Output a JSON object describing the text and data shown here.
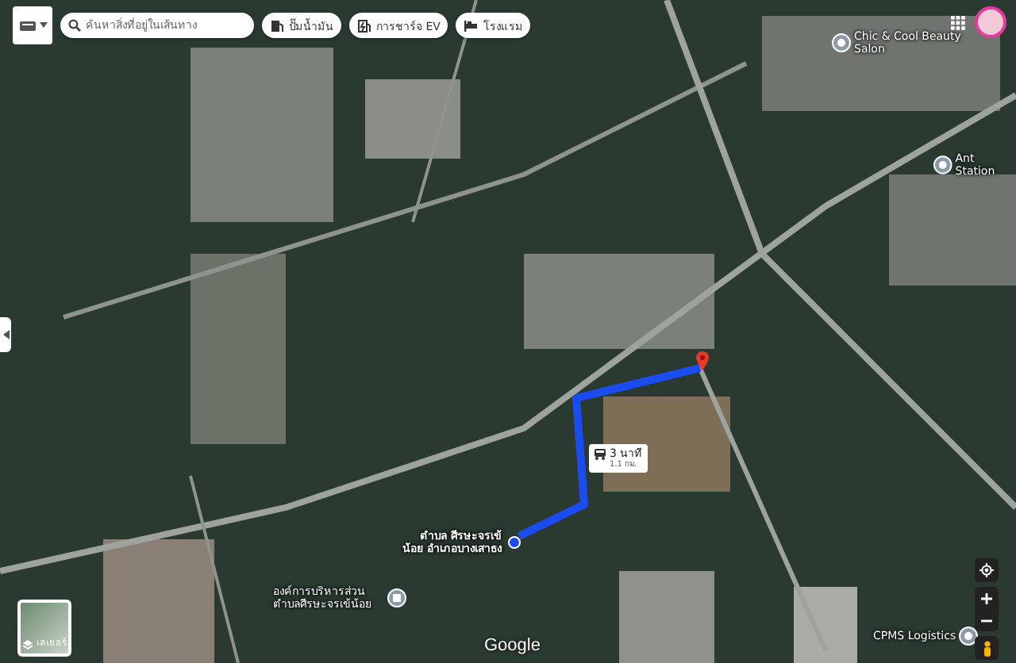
{
  "search": {
    "placeholder": "ค้นหาสิ่งที่อยู่ในเส้นทาง"
  },
  "chips": [
    {
      "label": "ปั๊มน้ำมัน",
      "kind": "fuel"
    },
    {
      "label": "การชาร์จ EV",
      "kind": "ev"
    },
    {
      "label": "โรงแรม",
      "kind": "hotel"
    }
  ],
  "places": [
    {
      "name": "Chic & Cool Beauty Salon",
      "kind": "place"
    },
    {
      "name": "Ant Station",
      "kind": "place"
    },
    {
      "name": "องค์การบริหารส่วนตำบลศีรษะจรเข้น้อย",
      "kind": "gov"
    },
    {
      "name": "CPMS Logistics",
      "kind": "place"
    }
  ],
  "destination": {
    "name": "ตำบล ศีรษะจรเข้น้อย อำเภอบางเสาธง"
  },
  "route": {
    "duration": "3 นาที",
    "distance": "1.1 กม."
  },
  "layers": {
    "label": "เลเยอร์"
  },
  "attribution": "Google"
}
